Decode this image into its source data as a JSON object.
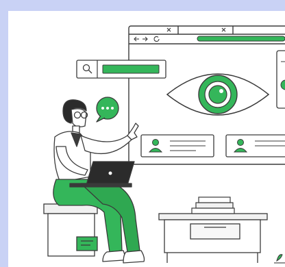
{
  "illustration": {
    "subject": "person-with-laptop-viewing-browser-eye",
    "palette": {
      "accent": "#34b65a",
      "accent_dark": "#1f8f45",
      "accent_light": "#6fd08a",
      "outline": "#3a3a3a",
      "frame_bg": "#c9d2f5",
      "panel": "#ffffff",
      "light_gray": "#f1f1f1"
    },
    "icons": [
      "search-icon",
      "eye-icon",
      "user-icon",
      "chat-bubble-icon",
      "laptop-icon",
      "close-icon",
      "refresh-icon"
    ]
  }
}
